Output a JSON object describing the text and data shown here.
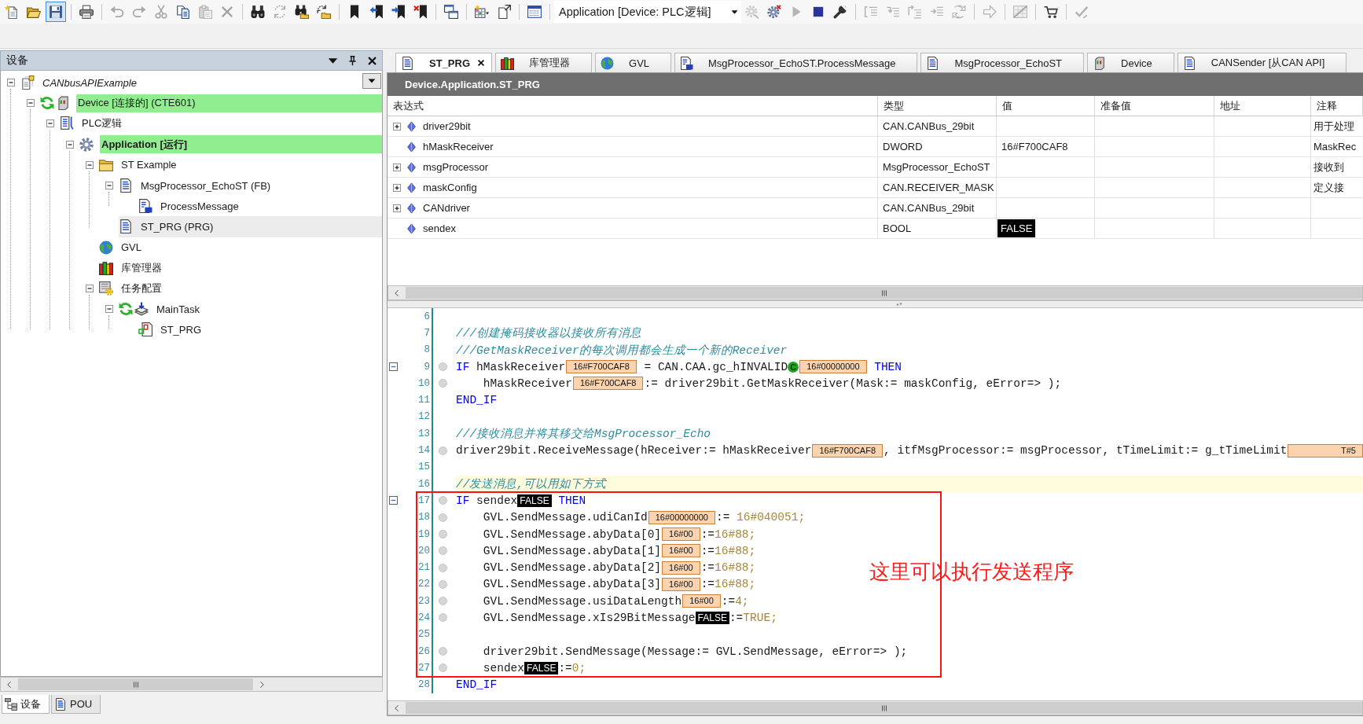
{
  "toolbar": {
    "groups_left": [
      [
        {
          "kind": "new",
          "disabled": false,
          "pressed": false
        },
        {
          "kind": "open",
          "disabled": false,
          "pressed": false
        },
        {
          "kind": "save",
          "disabled": false,
          "pressed": true
        }
      ],
      [
        {
          "kind": "print",
          "disabled": false,
          "pressed": false
        }
      ],
      [
        {
          "kind": "undo",
          "disabled": true,
          "pressed": false
        },
        {
          "kind": "redo",
          "disabled": true,
          "pressed": false
        },
        {
          "kind": "cut",
          "disabled": true,
          "pressed": false
        },
        {
          "kind": "copy",
          "disabled": false,
          "pressed": false
        },
        {
          "kind": "paste",
          "disabled": true,
          "pressed": false
        },
        {
          "kind": "delete",
          "disabled": true,
          "pressed": false
        }
      ],
      [
        {
          "kind": "find",
          "disabled": false,
          "pressed": false
        },
        {
          "kind": "replace",
          "disabled": true,
          "pressed": false
        },
        {
          "kind": "findall",
          "disabled": false,
          "pressed": false
        },
        {
          "kind": "replaceall",
          "disabled": false,
          "pressed": false
        }
      ],
      [
        {
          "kind": "bookmark",
          "disabled": false,
          "pressed": false
        },
        {
          "kind": "prevmark",
          "disabled": false,
          "pressed": false
        },
        {
          "kind": "nextmark",
          "disabled": false,
          "pressed": false
        },
        {
          "kind": "clearmarks",
          "disabled": false,
          "pressed": false
        }
      ],
      [
        {
          "kind": "windows",
          "disabled": false,
          "pressed": false
        }
      ],
      [
        {
          "kind": "insert",
          "disabled": false,
          "pressed": false
        },
        {
          "kind": "export",
          "disabled": false,
          "pressed": false
        }
      ],
      [
        {
          "kind": "grid",
          "disabled": false,
          "pressed": false
        }
      ]
    ],
    "app_selector": {
      "value": "Application [Device: PLC逻辑]"
    },
    "groups_right": [
      [
        {
          "kind": "login",
          "disabled": true,
          "pressed": false
        },
        {
          "kind": "logout",
          "disabled": false,
          "pressed": false
        },
        {
          "kind": "start",
          "disabled": true,
          "pressed": false
        },
        {
          "kind": "stop",
          "disabled": false,
          "pressed": false
        },
        {
          "kind": "reset",
          "disabled": false,
          "pressed": false
        }
      ],
      [
        {
          "kind": "stepover",
          "disabled": true,
          "pressed": false
        },
        {
          "kind": "stepinto",
          "disabled": true,
          "pressed": false
        },
        {
          "kind": "stepout",
          "disabled": true,
          "pressed": false
        },
        {
          "kind": "runto",
          "disabled": true,
          "pressed": false
        },
        {
          "kind": "setnext",
          "disabled": true,
          "pressed": false
        }
      ],
      [
        {
          "kind": "showstatement",
          "disabled": true,
          "pressed": false
        }
      ],
      [
        {
          "kind": "force",
          "disabled": true,
          "pressed": false
        }
      ],
      [
        {
          "kind": "cart",
          "disabled": false,
          "pressed": false
        }
      ],
      [
        {
          "kind": "confirm",
          "disabled": true,
          "pressed": false
        }
      ]
    ]
  },
  "devices_panel": {
    "title": "设备",
    "tree": [
      {
        "label": "CANbusAPIExample",
        "kind": "project",
        "expanded": true,
        "selected": false,
        "online": false,
        "running": false,
        "children": [
          {
            "label": "Device [连接的] (CTE601)",
            "kind": "device",
            "expanded": true,
            "selected": false,
            "online": true,
            "running": true,
            "children": [
              {
                "label": "PLC逻辑",
                "kind": "plc",
                "expanded": true,
                "selected": false,
                "online": false,
                "running": false,
                "children": [
                  {
                    "label": "Application [运行]",
                    "kind": "application",
                    "expanded": true,
                    "selected": false,
                    "online": true,
                    "running": false,
                    "children": [
                      {
                        "label": "ST Example",
                        "kind": "folder",
                        "expanded": true,
                        "selected": false,
                        "online": false,
                        "running": false,
                        "children": [
                          {
                            "label": "MsgProcessor_EchoST (FB)",
                            "kind": "pou",
                            "expanded": true,
                            "selected": false,
                            "online": false,
                            "running": false,
                            "children": [
                              {
                                "label": "ProcessMessage",
                                "kind": "method",
                                "selected": false,
                                "online": false,
                                "running": false
                              }
                            ]
                          },
                          {
                            "label": "ST_PRG (PRG)",
                            "kind": "pou",
                            "selected": true,
                            "online": false,
                            "running": false
                          }
                        ]
                      },
                      {
                        "label": "GVL",
                        "kind": "gvl",
                        "selected": false,
                        "online": false,
                        "running": false
                      },
                      {
                        "label": "库管理器",
                        "kind": "library",
                        "selected": false,
                        "online": false,
                        "running": false
                      },
                      {
                        "label": "任务配置",
                        "kind": "taskconfig",
                        "expanded": true,
                        "selected": false,
                        "online": false,
                        "running": false,
                        "children": [
                          {
                            "label": "MainTask",
                            "kind": "task",
                            "expanded": true,
                            "selected": false,
                            "online": false,
                            "running": true,
                            "children": [
                              {
                                "label": "ST_PRG",
                                "kind": "call",
                                "selected": false,
                                "online": false,
                                "running": false
                              }
                            ]
                          }
                        ]
                      }
                    ]
                  }
                ]
              }
            ]
          }
        ]
      }
    ],
    "bottom_tabs": [
      {
        "label": "设备",
        "kind": "devices",
        "selected": true
      },
      {
        "label": "POU",
        "kind": "pou",
        "selected": false
      }
    ]
  },
  "editor": {
    "tabs": [
      {
        "label": "ST_PRG",
        "kind": "pou",
        "selected": true
      },
      {
        "label": "库管理器",
        "kind": "library",
        "selected": false
      },
      {
        "label": "GVL",
        "kind": "gvl",
        "selected": false
      },
      {
        "label": "MsgProcessor_EchoST.ProcessMessage",
        "kind": "method",
        "selected": false
      },
      {
        "label": "MsgProcessor_EchoST",
        "kind": "pou",
        "selected": false
      },
      {
        "label": "Device",
        "kind": "device",
        "selected": false
      },
      {
        "label": "CANSender [从CAN API]",
        "kind": "pou",
        "selected": false
      }
    ],
    "path": "Device.Application.ST_PRG",
    "variables": {
      "columns": [
        "表达式",
        "类型",
        "值",
        "准备值",
        "地址",
        "注释"
      ],
      "rows": [
        {
          "expression": "driver29bit",
          "type": "CAN.CANBus_29bit",
          "comment": "用于处理",
          "expandable": true
        },
        {
          "expression": "hMaskReceiver",
          "type": "DWORD",
          "value": "16#F700CAF8",
          "kind": "number",
          "comment": "MaskRec",
          "expandable": false
        },
        {
          "expression": "msgProcessor",
          "type": "MsgProcessor_EchoST",
          "comment": "接收到",
          "expandable": true
        },
        {
          "expression": "maskConfig",
          "type": "CAN.RECEIVER_MASK",
          "comment": "定义接",
          "expandable": true
        },
        {
          "expression": "CANdriver",
          "type": "CAN.CANBus_29bit",
          "expandable": true
        },
        {
          "expression": "sendex",
          "type": "BOOL",
          "value": "FALSE",
          "kind": "bool",
          "expandable": false
        }
      ]
    },
    "code": {
      "lines": [
        {
          "number": "6",
          "fold": false,
          "marker": false,
          "current": false
        },
        {
          "number": "7",
          "fold": false,
          "marker": false,
          "current": false,
          "segments": [
            {
              "kind": "comment",
              "text": "///创建掩码接收器以接收所有消息"
            }
          ]
        },
        {
          "number": "8",
          "fold": false,
          "marker": false,
          "current": false,
          "segments": [
            {
              "kind": "comment",
              "text": "///GetMaskReceiver的每次调用都会生成一个新的Receiver"
            }
          ]
        },
        {
          "number": "9",
          "fold": true,
          "marker": true,
          "current": false,
          "segments": [
            {
              "kind": "kw",
              "text": "IF"
            },
            {
              "kind": "text",
              "text": " hMaskReceiver"
            },
            {
              "kind": "val",
              "text": "16#F700CAF8"
            },
            {
              "kind": "text",
              "text": " = CAN.CAA.gc_hINVALID"
            },
            {
              "kind": "const",
              "text": "C"
            },
            {
              "kind": "val",
              "text": "16#00000000"
            },
            {
              "kind": "kw",
              "text": " THEN"
            }
          ]
        },
        {
          "number": "10",
          "fold": false,
          "marker": true,
          "current": false,
          "segments": [
            {
              "kind": "text",
              "text": "    hMaskReceiver"
            },
            {
              "kind": "val",
              "text": "16#F700CAF8"
            },
            {
              "kind": "text",
              "text": ":= driver29bit.GetMaskReceiver(Mask:= maskConfig, eError=> );"
            }
          ]
        },
        {
          "number": "11",
          "fold": false,
          "marker": false,
          "current": false,
          "segments": [
            {
              "kind": "kw",
              "text": "END_IF"
            }
          ]
        },
        {
          "number": "12",
          "fold": false,
          "marker": false,
          "current": false
        },
        {
          "number": "13",
          "fold": false,
          "marker": false,
          "current": false,
          "segments": [
            {
              "kind": "comment",
              "text": "///接收消息并将其移交给MsgProcessor_Echo"
            }
          ]
        },
        {
          "number": "14",
          "fold": false,
          "marker": true,
          "current": false,
          "segments": [
            {
              "kind": "text",
              "text": "driver29bit.ReceiveMessage(hReceiver:= hMaskReceiver"
            },
            {
              "kind": "val",
              "text": "16#F700CAF8"
            },
            {
              "kind": "text",
              "text": ", itfMsgProcessor:= msgProcessor, tTimeLimit:= g_tTimeLimit"
            },
            {
              "kind": "val",
              "text": "T#5"
            }
          ]
        },
        {
          "number": "15",
          "fold": false,
          "marker": false,
          "current": false
        },
        {
          "number": "16",
          "fold": false,
          "marker": false,
          "current": true,
          "segments": [
            {
              "kind": "comment",
              "text": "//发送消息,可以用如下方式"
            }
          ]
        },
        {
          "number": "17",
          "fold": true,
          "marker": true,
          "current": false,
          "segments": [
            {
              "kind": "kw",
              "text": "IF"
            },
            {
              "kind": "text",
              "text": " sendex"
            },
            {
              "kind": "bool",
              "text": "FALSE"
            },
            {
              "kind": "kw",
              "text": " THEN"
            }
          ]
        },
        {
          "number": "18",
          "fold": false,
          "marker": true,
          "current": false,
          "segments": [
            {
              "kind": "text",
              "text": "    GVL.SendMessage.udiCanId"
            },
            {
              "kind": "val",
              "text": "16#00000000"
            },
            {
              "kind": "text",
              "text": ":="
            },
            {
              "kind": "lit",
              "text": " 16#040051;"
            }
          ]
        },
        {
          "number": "19",
          "fold": false,
          "marker": true,
          "current": false,
          "segments": [
            {
              "kind": "text",
              "text": "    GVL.SendMessage.abyData[0]"
            },
            {
              "kind": "val",
              "text": "16#00"
            },
            {
              "kind": "text",
              "text": ":="
            },
            {
              "kind": "lit",
              "text": "16#88;"
            }
          ]
        },
        {
          "number": "20",
          "fold": false,
          "marker": true,
          "current": false,
          "segments": [
            {
              "kind": "text",
              "text": "    GVL.SendMessage.abyData[1]"
            },
            {
              "kind": "val",
              "text": "16#00"
            },
            {
              "kind": "text",
              "text": ":="
            },
            {
              "kind": "lit",
              "text": "16#88;"
            }
          ]
        },
        {
          "number": "21",
          "fold": false,
          "marker": true,
          "current": false,
          "segments": [
            {
              "kind": "text",
              "text": "    GVL.SendMessage.abyData[2]"
            },
            {
              "kind": "val",
              "text": "16#00"
            },
            {
              "kind": "text",
              "text": ":="
            },
            {
              "kind": "lit",
              "text": "16#88;"
            }
          ]
        },
        {
          "number": "22",
          "fold": false,
          "marker": true,
          "current": false,
          "segments": [
            {
              "kind": "text",
              "text": "    GVL.SendMessage.abyData[3]"
            },
            {
              "kind": "val",
              "text": "16#00"
            },
            {
              "kind": "text",
              "text": ":="
            },
            {
              "kind": "lit",
              "text": "16#88;"
            }
          ]
        },
        {
          "number": "23",
          "fold": false,
          "marker": true,
          "current": false,
          "segments": [
            {
              "kind": "text",
              "text": "    GVL.SendMessage.usiDataLength"
            },
            {
              "kind": "val",
              "text": "16#00"
            },
            {
              "kind": "text",
              "text": ":="
            },
            {
              "kind": "lit",
              "text": "4;"
            }
          ]
        },
        {
          "number": "24",
          "fold": false,
          "marker": true,
          "current": false,
          "segments": [
            {
              "kind": "text",
              "text": "    GVL.SendMessage.xIs29BitMessage"
            },
            {
              "kind": "bool",
              "text": "FALSE"
            },
            {
              "kind": "text",
              "text": ":="
            },
            {
              "kind": "lit",
              "text": "TRUE;"
            }
          ]
        },
        {
          "number": "25",
          "fold": false,
          "marker": false,
          "current": false
        },
        {
          "number": "26",
          "fold": false,
          "marker": true,
          "current": false,
          "segments": [
            {
              "kind": "text",
              "text": "    driver29bit.SendMessage(Message:= GVL.SendMessage, eError=> );"
            }
          ]
        },
        {
          "number": "27",
          "fold": false,
          "marker": true,
          "current": false,
          "segments": [
            {
              "kind": "text",
              "text": "    sendex"
            },
            {
              "kind": "bool",
              "text": "FALSE"
            },
            {
              "kind": "text",
              "text": ":="
            },
            {
              "kind": "lit",
              "text": "0;"
            }
          ]
        },
        {
          "number": "28",
          "fold": false,
          "marker": false,
          "current": false,
          "segments": [
            {
              "kind": "kw",
              "text": "END_IF"
            }
          ]
        }
      ]
    },
    "annotation": {
      "text": "这里可以执行发送程序"
    }
  }
}
